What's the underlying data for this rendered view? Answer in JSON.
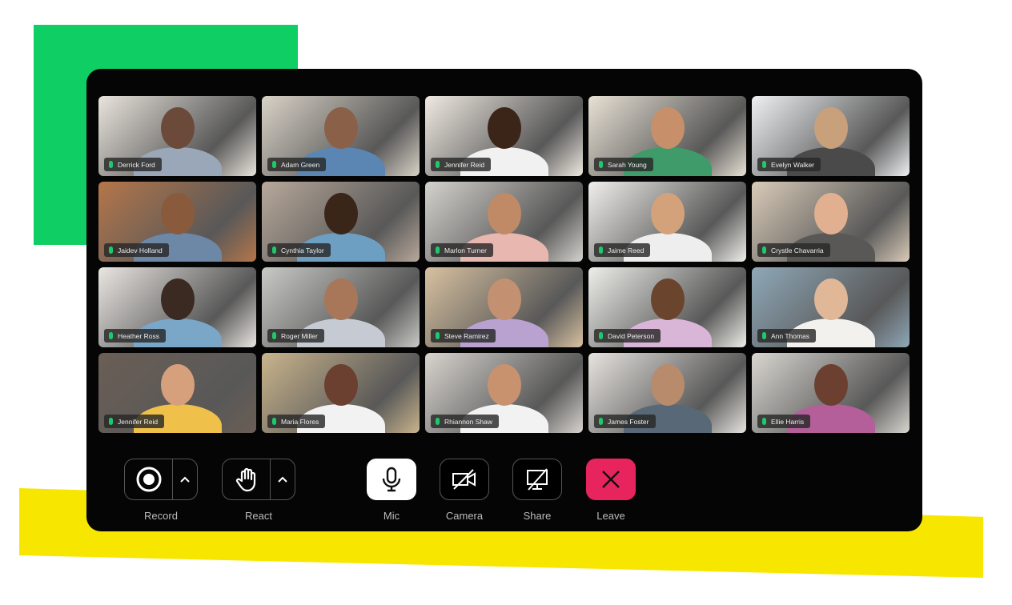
{
  "colors": {
    "accent_green": "#0fce63",
    "accent_yellow": "#f7e600",
    "leave": "#e8245f",
    "panel": "#050505",
    "speaking": "#1ec96b"
  },
  "participants": [
    {
      "name": "Derrick Ford"
    },
    {
      "name": "Adam Green"
    },
    {
      "name": "Jennifer Reid"
    },
    {
      "name": "Sarah Young"
    },
    {
      "name": "Evelyn Walker"
    },
    {
      "name": "Jaidev Holland"
    },
    {
      "name": "Cynthia Taylor"
    },
    {
      "name": "Marlon Turner"
    },
    {
      "name": "Jaime Reed"
    },
    {
      "name": "Crystle Chavarria"
    },
    {
      "name": "Heather Ross"
    },
    {
      "name": "Roger Miller"
    },
    {
      "name": "Steve Ramirez"
    },
    {
      "name": "David Peterson"
    },
    {
      "name": "Ann Thomas"
    },
    {
      "name": "Jennifer Reid"
    },
    {
      "name": "Maria Flores"
    },
    {
      "name": "Rhiannon Shaw"
    },
    {
      "name": "James Foster"
    },
    {
      "name": "Ellie Harris"
    }
  ],
  "controls": {
    "record": "Record",
    "react": "React",
    "mic": "Mic",
    "camera": "Camera",
    "share": "Share",
    "leave": "Leave"
  }
}
